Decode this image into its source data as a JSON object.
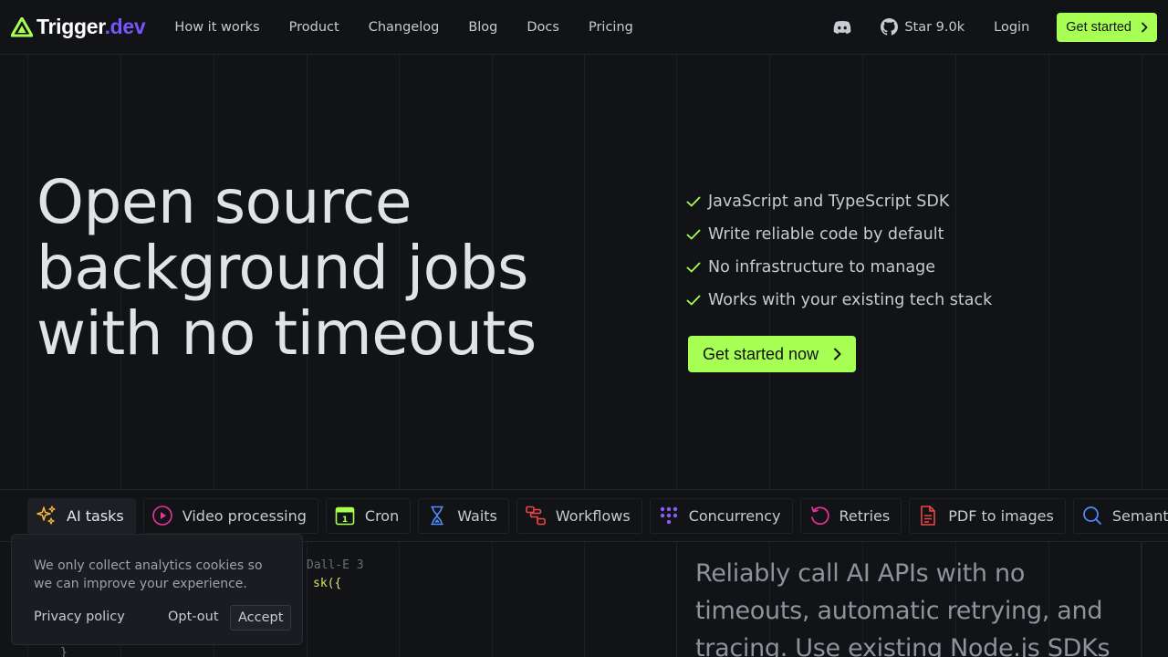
{
  "brand": {
    "name_part1": "Trigger",
    "name_part2": ".dev",
    "accent": "#a8ff53",
    "brand_purple": "#7655fd"
  },
  "nav": {
    "items": [
      {
        "label": "How it works"
      },
      {
        "label": "Product"
      },
      {
        "label": "Changelog"
      },
      {
        "label": "Blog"
      },
      {
        "label": "Docs"
      },
      {
        "label": "Pricing"
      }
    ]
  },
  "header": {
    "discord_icon": "discord-icon",
    "github_label": "Star 9.0k",
    "login_label": "Login",
    "cta_label": "Get started"
  },
  "hero": {
    "title_line1": "Open source",
    "title_line2": "background jobs",
    "title_line3": "with no timeouts",
    "features": [
      "JavaScript and TypeScript SDK",
      "Write reliable code by default",
      "No infrastructure to manage",
      "Works with your existing tech stack"
    ],
    "cta_label": "Get started now"
  },
  "tabs": [
    {
      "label": "AI tasks",
      "icon": "sparkles-icon",
      "color": "#f5b83d",
      "active": true
    },
    {
      "label": "Video processing",
      "icon": "play-circle-icon",
      "color": "#e8339a"
    },
    {
      "label": "Cron",
      "icon": "calendar-icon",
      "color": "#a8ff53"
    },
    {
      "label": "Waits",
      "icon": "hourglass-icon",
      "color": "#4f8dfd"
    },
    {
      "label": "Workflows",
      "icon": "workflow-icon",
      "color": "#ef4444"
    },
    {
      "label": "Concurrency",
      "icon": "dots-grid-icon",
      "color": "#8b5cf6"
    },
    {
      "label": "Retries",
      "icon": "retry-icon",
      "color": "#e8339a"
    },
    {
      "label": "PDF to images",
      "icon": "document-icon",
      "color": "#ef4444"
    },
    {
      "label": "Semantic",
      "icon": "search-icon",
      "color": "#4f8dfd"
    }
  ],
  "code": {
    "line1": "Dall-E 3",
    "line2": "sk({",
    "line3": "}"
  },
  "panel": {
    "text": "Reliably call AI APIs with no timeouts, automatic retrying, and tracing. Use existing Node.js SDKs"
  },
  "cookie": {
    "text": "We only collect analytics cookies so we can improve your experience.",
    "privacy_label": "Privacy policy",
    "optout_label": "Opt-out",
    "accept_label": "Accept"
  }
}
